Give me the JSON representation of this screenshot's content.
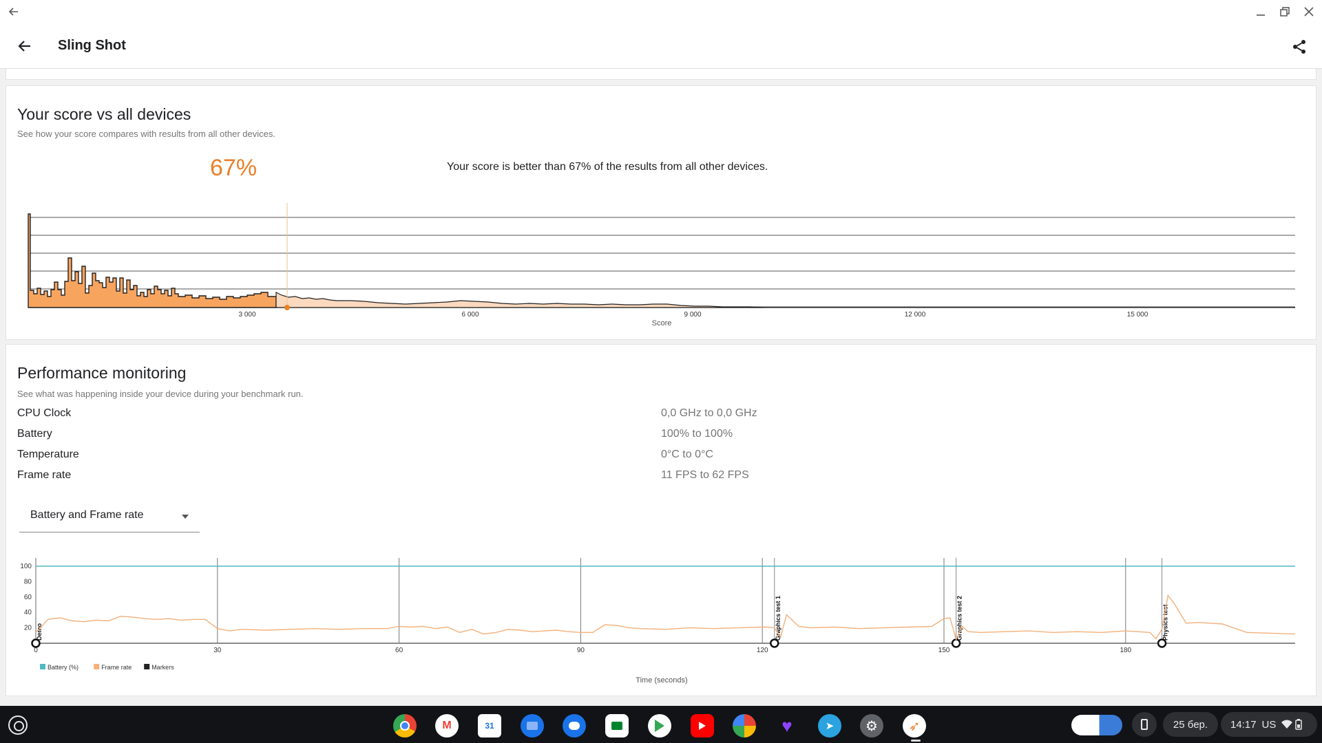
{
  "app": {
    "title": "Sling Shot"
  },
  "score_section": {
    "title": "Your score vs all devices",
    "subtitle": "See how your score compares with results from all other devices.",
    "percentile": "67%",
    "percentile_text": "Your score is better than 67% of the results from all other devices."
  },
  "distribution_chart": {
    "type": "area",
    "xlabel": "Score",
    "tick_labels": [
      "3 000",
      "6 000",
      "9 000",
      "12 000",
      "15 000"
    ],
    "your_score_marker": 3500,
    "accent": "#f0a060"
  },
  "performance": {
    "title": "Performance monitoring",
    "subtitle": "See what was happening inside your device during your benchmark run.",
    "metrics": [
      {
        "label": "CPU Clock",
        "value": "0,0 GHz to 0,0 GHz"
      },
      {
        "label": "Battery",
        "value": "100% to 100%"
      },
      {
        "label": "Temperature",
        "value": "0°C to 0°C"
      },
      {
        "label": "Frame rate",
        "value": "11 FPS to 62 FPS"
      }
    ],
    "dropdown_value": "Battery and Frame rate"
  },
  "chart_data": {
    "type": "line",
    "xlabel": "Time (seconds)",
    "ylabel": "",
    "xlim": [
      0,
      208
    ],
    "ylim": [
      0,
      100
    ],
    "x_ticks": [
      "0",
      "30",
      "60",
      "90",
      "120",
      "150",
      "180"
    ],
    "y_ticks": [
      "100",
      "80",
      "60",
      "40",
      "20"
    ],
    "markers": [
      {
        "label": "Demo",
        "x": 0
      },
      {
        "label": "Graphics test 1",
        "x": 122
      },
      {
        "label": "Graphics test 2",
        "x": 152
      },
      {
        "label": "Physics test",
        "x": 186
      }
    ],
    "legend": [
      "Battery (%)",
      "Frame rate",
      "Markers"
    ],
    "legend_colors": [
      "#4fb8c0",
      "#f3b07a",
      "#222222"
    ],
    "series": [
      {
        "name": "Battery (%)",
        "x": [
          0,
          208
        ],
        "values": [
          100,
          100
        ]
      },
      {
        "name": "Frame rate",
        "x": [
          0,
          1,
          2,
          4,
          6,
          8,
          10,
          12,
          14,
          16,
          18,
          20,
          22,
          24,
          26,
          28,
          30,
          32,
          34,
          38,
          42,
          46,
          50,
          54,
          58,
          60,
          62,
          64,
          66,
          68,
          70,
          72,
          74,
          76,
          78,
          80,
          82,
          84,
          86,
          88,
          90,
          92,
          94,
          96,
          98,
          100,
          104,
          108,
          112,
          116,
          120,
          121,
          122,
          123,
          124,
          126,
          128,
          132,
          136,
          140,
          144,
          148,
          150,
          151,
          152,
          153,
          154,
          156,
          160,
          164,
          168,
          172,
          176,
          180,
          182,
          184,
          185,
          186,
          187,
          188,
          190,
          192,
          196,
          200,
          204,
          208
        ],
        "values": [
          14,
          22,
          31,
          33,
          29,
          28,
          30,
          29,
          35,
          34,
          32,
          31,
          32,
          30,
          31,
          31,
          19,
          16,
          18,
          17,
          18,
          19,
          18,
          19,
          19,
          22,
          21,
          22,
          19,
          21,
          14,
          18,
          12,
          14,
          18,
          17,
          15,
          16,
          17,
          15,
          14,
          14,
          24,
          23,
          20,
          19,
          18,
          20,
          19,
          20,
          21,
          21,
          20,
          8,
          37,
          22,
          20,
          21,
          19,
          20,
          21,
          22,
          32,
          33,
          5,
          22,
          15,
          14,
          15,
          16,
          14,
          15,
          14,
          16,
          15,
          14,
          6,
          18,
          62,
          52,
          26,
          27,
          25,
          14,
          13,
          12
        ]
      }
    ]
  },
  "taskbar": {
    "date": "25 бер.",
    "time": "14:17",
    "locale": "US"
  }
}
